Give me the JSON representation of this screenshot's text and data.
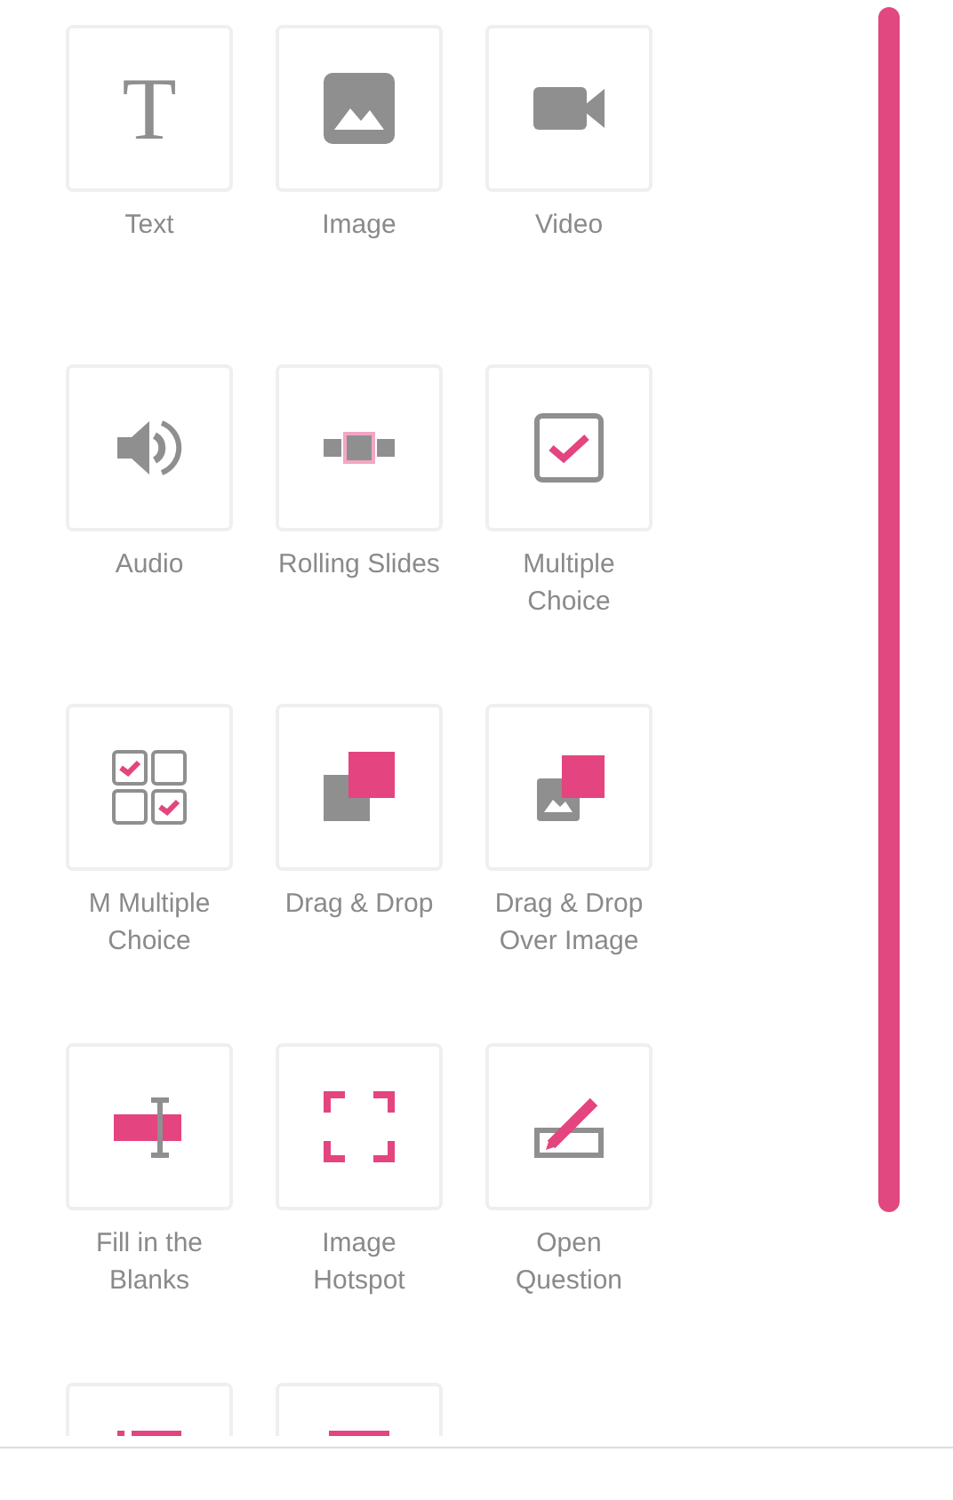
{
  "elements": [
    {
      "kind": "text",
      "label": "Text",
      "glyph": "T"
    },
    {
      "kind": "image",
      "label": "Image"
    },
    {
      "kind": "video",
      "label": "Video"
    },
    {
      "kind": "audio",
      "label": "Audio"
    },
    {
      "kind": "slides",
      "label": "Rolling Slides"
    },
    {
      "kind": "choice",
      "label": "Multiple Choice"
    },
    {
      "kind": "multi",
      "label": "M Multiple Choice"
    },
    {
      "kind": "dragdrop",
      "label": "Drag & Drop"
    },
    {
      "kind": "dragimage",
      "label": "Drag & Drop Over Image"
    },
    {
      "kind": "blanks",
      "label": "Fill in the Blanks"
    },
    {
      "kind": "hotspot",
      "label": "Image Hotspot"
    },
    {
      "kind": "open",
      "label": "Open Question"
    },
    {
      "kind": "list"
    },
    {
      "kind": "bar"
    }
  ]
}
